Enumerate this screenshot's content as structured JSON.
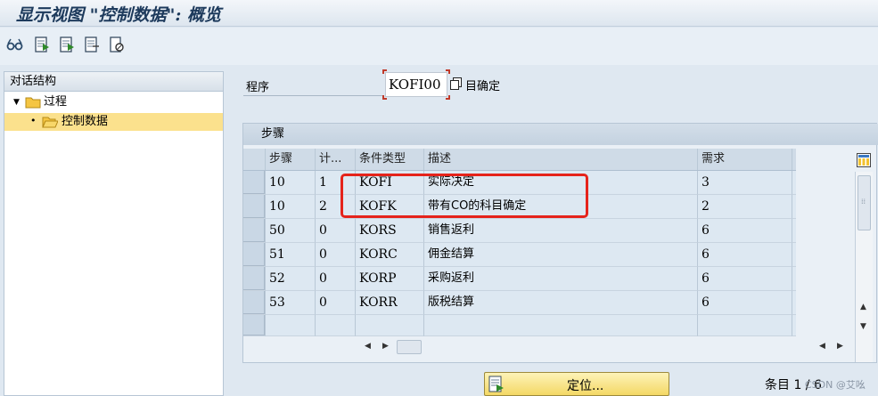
{
  "window": {
    "title": "显示视图 \"控制数据\": 概览"
  },
  "toolbar": {
    "buttons": [
      {
        "icon": "glasses-display-icon"
      },
      {
        "icon": "select-block-icon"
      },
      {
        "icon": "previous-entry-icon"
      },
      {
        "icon": "next-entry-icon"
      },
      {
        "icon": "print-icon"
      }
    ]
  },
  "sidebar": {
    "header": "对话结构",
    "items": [
      {
        "label": "过程",
        "level": 0,
        "expanded": true
      },
      {
        "label": "控制数据",
        "level": 1,
        "selected": true
      }
    ]
  },
  "program_field": {
    "label": "程序",
    "value": "KOFI00",
    "description": "目确定"
  },
  "steps_table": {
    "title": "步骤",
    "columns": [
      "步骤",
      "计...",
      "条件类型",
      "描述",
      "需求"
    ],
    "rows": [
      {
        "step": "10",
        "counter": "1",
        "cond_type": "KOFI",
        "desc": "实际决定",
        "req": "3"
      },
      {
        "step": "10",
        "counter": "2",
        "cond_type": "KOFK",
        "desc": "带有CO的科目确定",
        "req": "2"
      },
      {
        "step": "50",
        "counter": "0",
        "cond_type": "KORS",
        "desc": "销售返利",
        "req": "6"
      },
      {
        "step": "51",
        "counter": "0",
        "cond_type": "KORC",
        "desc": "佣金结算",
        "req": "6"
      },
      {
        "step": "52",
        "counter": "0",
        "cond_type": "KORP",
        "desc": "采购返利",
        "req": "6"
      },
      {
        "step": "53",
        "counter": "0",
        "cond_type": "KORR",
        "desc": "版税结算",
        "req": "6"
      },
      {
        "step": "",
        "counter": "",
        "cond_type": "",
        "desc": "",
        "req": ""
      }
    ]
  },
  "footer": {
    "locate_label": "定位...",
    "entry_info": "条目 1 / 6",
    "watermark": "CSDN @艾吆"
  },
  "colors": {
    "highlight_border": "#e5231b",
    "selected_tree_row": "#fbe18d",
    "button_yellow": "#f4d865"
  }
}
